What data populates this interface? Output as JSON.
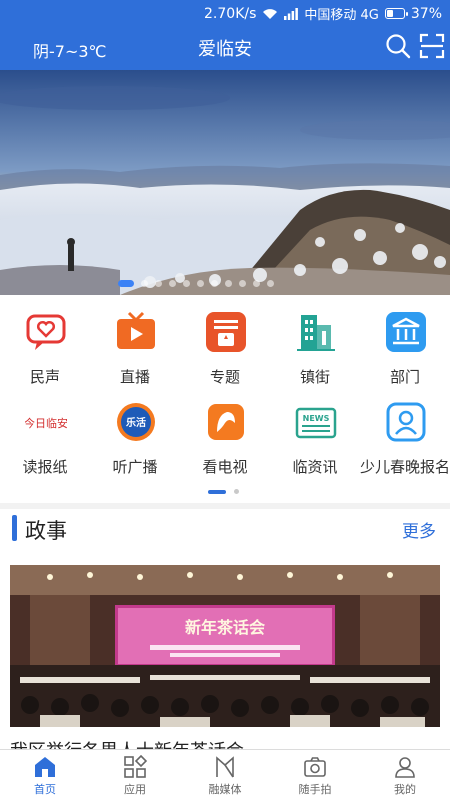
{
  "status_bar": {
    "speed": "2.70K/s",
    "carrier": "中国移动 4G",
    "battery": "37%"
  },
  "header": {
    "weather": "阴-7~3℃",
    "title": "爱临安",
    "icons": [
      "search-icon",
      "scan-icon"
    ]
  },
  "banner": {
    "slide_count": 11,
    "active_slide": 1
  },
  "grid": {
    "page_indicator": {
      "pages": 2,
      "active": 1
    },
    "items": [
      {
        "label": "民声",
        "icon": "chat-heart-icon",
        "color": "#e53935"
      },
      {
        "label": "直播",
        "icon": "live-tv-icon",
        "color": "#f06a23"
      },
      {
        "label": "专题",
        "icon": "topic-icon",
        "color": "#e8542a"
      },
      {
        "label": "镇街",
        "icon": "buildings-icon",
        "color": "#23a394"
      },
      {
        "label": "部门",
        "icon": "institution-icon",
        "color": "#2e9bf0"
      },
      {
        "label": "读报纸",
        "icon": "newspaper-logo-icon",
        "logo_text": "今日临安",
        "color": "#d32f2f"
      },
      {
        "label": "听广播",
        "icon": "radio-logo-icon",
        "logo_text": "乐活",
        "color": "#1e5bb8"
      },
      {
        "label": "看电视",
        "icon": "tv-logo-icon",
        "color": "#f47a20"
      },
      {
        "label": "临资讯",
        "icon": "news-icon",
        "logo_text": "NEWS",
        "color": "#2aa38e"
      },
      {
        "label": "少儿春晚报名",
        "icon": "person-badge-icon",
        "color": "#2e9bf0"
      }
    ]
  },
  "section": {
    "title": "政事",
    "more": "更多",
    "article": {
      "title": "我区举行各界人士新年茶话会",
      "image_banner_text": "新年茶话会"
    }
  },
  "tabbar": {
    "items": [
      {
        "label": "首页",
        "icon": "home-icon",
        "active": true
      },
      {
        "label": "应用",
        "icon": "apps-icon",
        "active": false
      },
      {
        "label": "融媒体",
        "icon": "media-icon",
        "active": false
      },
      {
        "label": "随手拍",
        "icon": "camera-icon",
        "active": false
      },
      {
        "label": "我的",
        "icon": "user-icon",
        "active": false
      }
    ]
  },
  "colors": {
    "primary": "#2f6fd9"
  }
}
